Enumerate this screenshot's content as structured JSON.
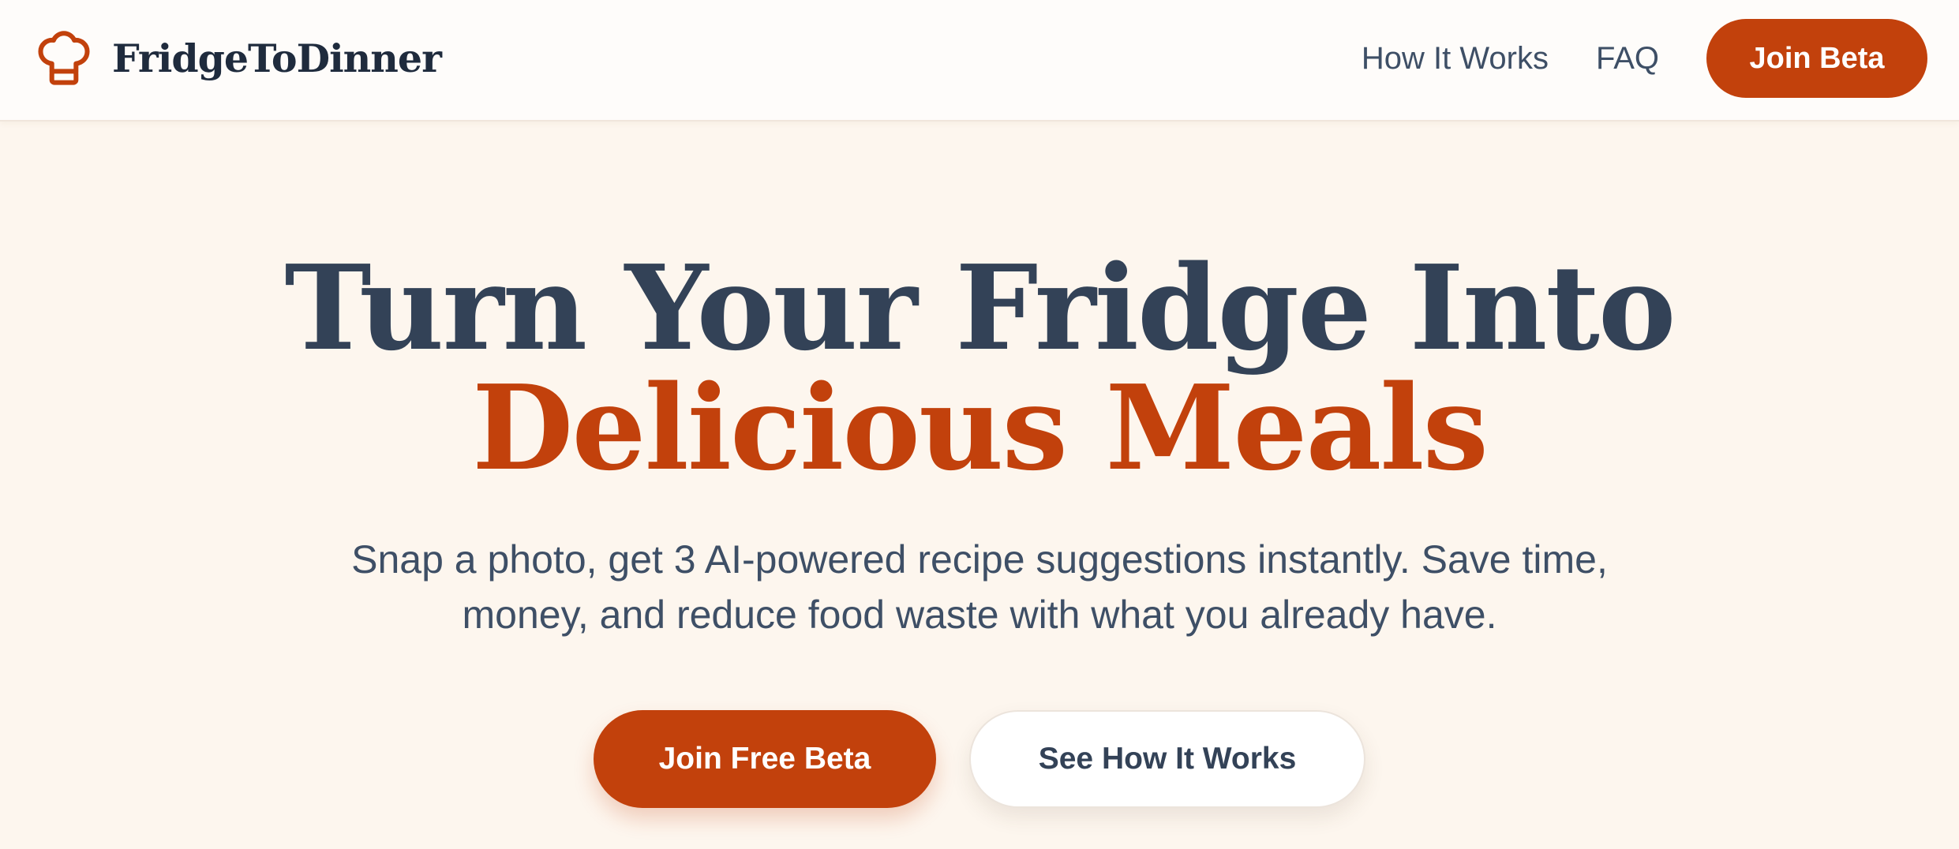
{
  "header": {
    "brand_name": "FridgeToDinner",
    "brand_icon": "chef-hat-icon",
    "nav": {
      "how_it_works": "How It Works",
      "faq": "FAQ"
    },
    "join_beta_label": "Join Beta"
  },
  "hero": {
    "title_line_1": "Turn Your Fridge Into",
    "title_line_2": "Delicious Meals",
    "subtitle": "Snap a photo, get 3 AI-powered recipe suggestions instantly. Save time, money, and reduce food waste with what you already have.",
    "primary_cta": "Join Free Beta",
    "secondary_cta": "See How It Works"
  },
  "colors": {
    "accent": "#c2410c",
    "heading": "#334257",
    "body_text": "#3e4f66",
    "background": "#fdf6ee",
    "header_background": "#fefcfa"
  }
}
